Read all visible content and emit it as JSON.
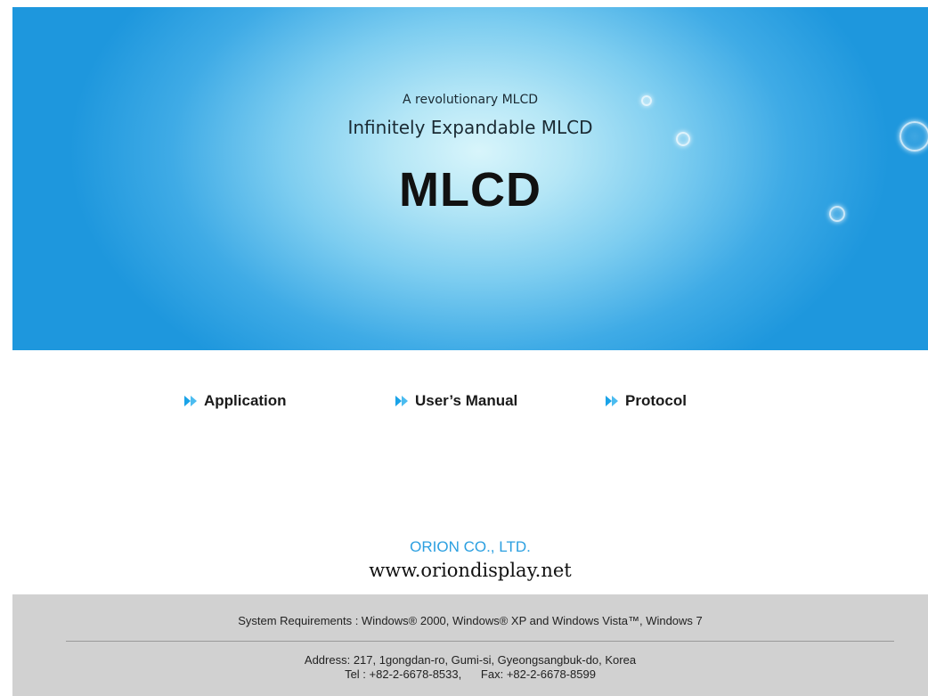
{
  "hero": {
    "tagline": "A revolutionary MLCD",
    "subtitle": "Infinitely Expandable MLCD",
    "product": "MLCD"
  },
  "links": [
    {
      "label": "Application",
      "icon": "double-arrow-icon"
    },
    {
      "label": "User’s Manual",
      "icon": "double-arrow-icon"
    },
    {
      "label": "Protocol",
      "icon": "double-arrow-icon"
    }
  ],
  "company": {
    "name": "ORION CO., LTD.",
    "website": "www.oriondisplay.net"
  },
  "footer": {
    "system_requirements": "System Requirements : Windows® 2000, Windows® XP and Windows Vista™, Windows 7",
    "address": "Address: 217, 1gongdan-ro, Gumi-si, Gyeongsangbuk-do, Korea",
    "tel": "Tel : +82-2-6678-8533,",
    "fax": "Fax: +82-2-6678-8599"
  },
  "colors": {
    "accent": "#1aa3e8",
    "company": "#2b9fe0",
    "footer_bg": "#d1d1d1"
  }
}
